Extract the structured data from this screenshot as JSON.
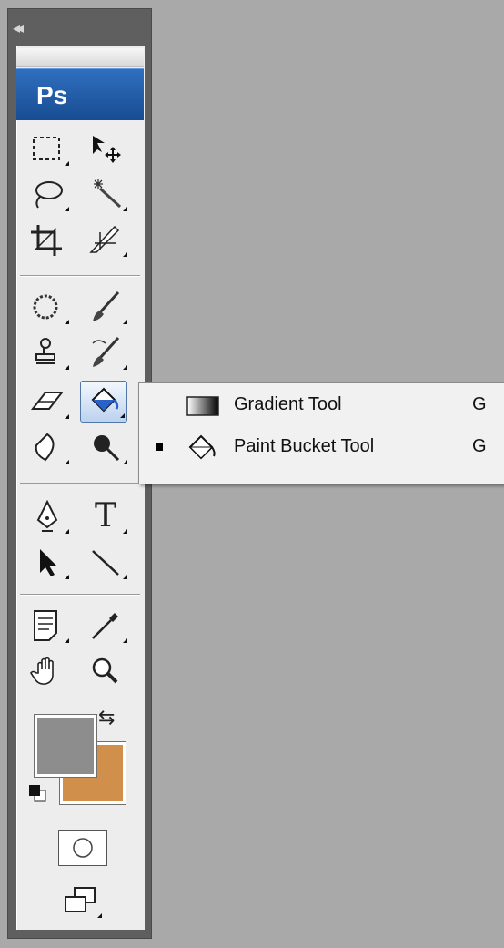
{
  "panel": {
    "collapse_label": "◂◂",
    "logo": "Ps"
  },
  "tools": [
    {
      "name": "marquee-tool-icon"
    },
    {
      "name": "move-tool-icon"
    },
    {
      "name": "lasso-tool-icon"
    },
    {
      "name": "magic-wand-tool-icon"
    },
    {
      "name": "crop-tool-icon"
    },
    {
      "name": "slice-tool-icon"
    },
    {
      "name": "spot-healing-brush-icon"
    },
    {
      "name": "brush-tool-icon"
    },
    {
      "name": "clone-stamp-tool-icon"
    },
    {
      "name": "history-brush-tool-icon"
    },
    {
      "name": "eraser-tool-icon"
    },
    {
      "name": "paint-bucket-tool-icon",
      "active": true
    },
    {
      "name": "blur-tool-icon"
    },
    {
      "name": "dodge-tool-icon"
    },
    {
      "name": "pen-tool-icon"
    },
    {
      "name": "type-tool-icon",
      "glyph": "T"
    },
    {
      "name": "path-selection-tool-icon"
    },
    {
      "name": "line-tool-icon"
    },
    {
      "name": "notes-tool-icon"
    },
    {
      "name": "eyedropper-tool-icon"
    },
    {
      "name": "hand-tool-icon"
    },
    {
      "name": "zoom-tool-icon"
    }
  ],
  "flyout": {
    "items": [
      {
        "label": "Gradient Tool",
        "shortcut": "G",
        "selected": false,
        "icon": "gradient-icon"
      },
      {
        "label": "Paint Bucket Tool",
        "shortcut": "G",
        "selected": true,
        "icon": "paint-bucket-icon"
      }
    ]
  },
  "colors": {
    "foreground": "#8d8d8d",
    "background": "#d0904c",
    "panel_bg": "#ededed",
    "logo_blue": "#184c92",
    "workspace": "#a9a9a9"
  }
}
